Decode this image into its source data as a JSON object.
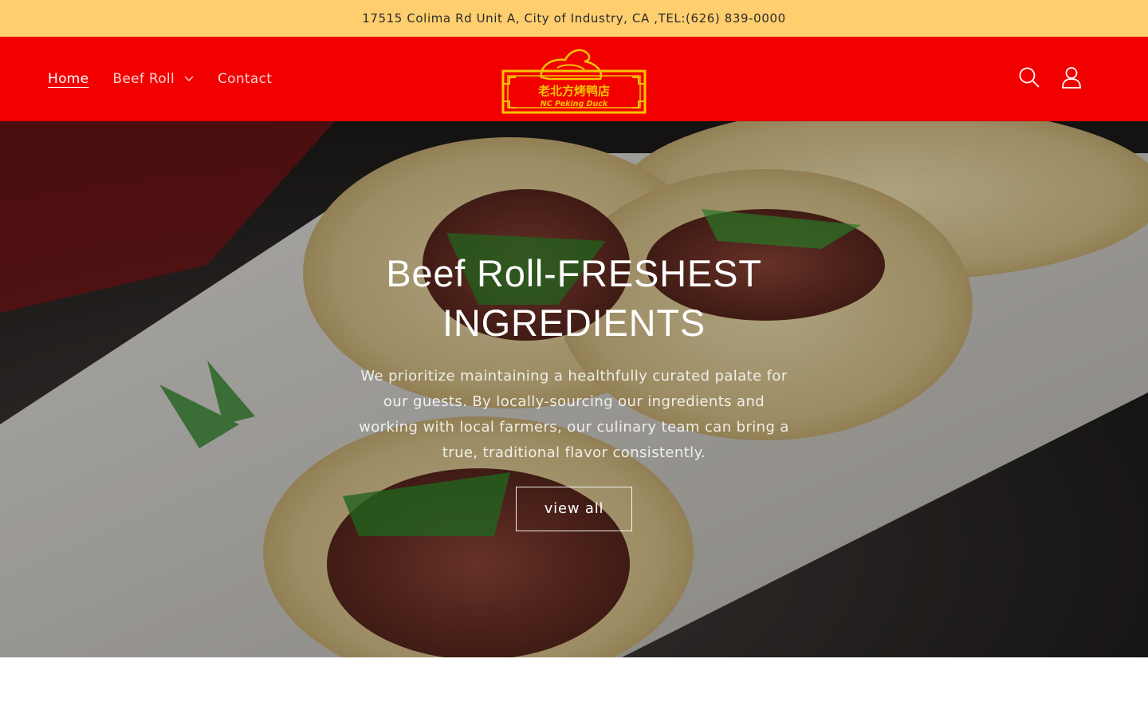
{
  "announcement": {
    "text": "17515 Colima Rd Unit A, City of Industry, CA ,TEL:(626) 839-0000"
  },
  "header": {
    "nav": [
      {
        "label": "Home",
        "active": true
      },
      {
        "label": "Beef Roll",
        "has_dropdown": true
      },
      {
        "label": "Contact"
      }
    ],
    "logo": {
      "chinese": "老北方烤鸭店",
      "english": "NC Peking Duck"
    },
    "icons": [
      "search-icon",
      "account-icon"
    ]
  },
  "hero": {
    "title": "Beef Roll-FRESHEST INGREDIENTS",
    "text": "We prioritize maintaining a healthfully curated palate for our guests. By locally-sourcing our ingredients and working with local farmers, our culinary team can bring a true, traditional flavor consistently.",
    "button_label": "view all"
  },
  "colors": {
    "announcement_bg": "#ffcf6f",
    "header_bg": "#f20000",
    "logo_gold": "#f5c400"
  }
}
